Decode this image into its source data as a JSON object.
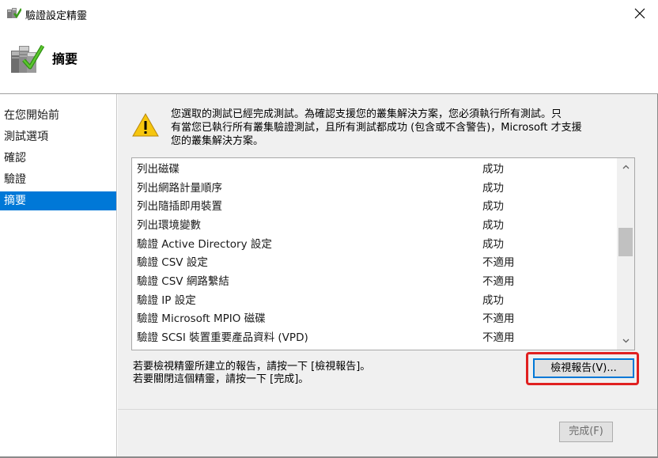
{
  "window": {
    "title": "驗證設定精靈",
    "close_glyph": "✕"
  },
  "header": {
    "title": "摘要"
  },
  "nav": {
    "items": [
      {
        "label": "在您開始前",
        "active": false
      },
      {
        "label": "測試選項",
        "active": false
      },
      {
        "label": "確認",
        "active": false
      },
      {
        "label": "驗證",
        "active": false
      },
      {
        "label": "摘要",
        "active": true
      }
    ]
  },
  "warning": {
    "lines": [
      "您選取的測試已經完成測試。為確認支援您的叢集解決方案，您必須執行所有測試。只",
      "有當您已執行所有叢集驗證測試，且所有測試都成功 (包含或不含警告)，Microsoft 才支援",
      "您的叢集解決方案。"
    ]
  },
  "results": {
    "rows": [
      {
        "name": "列出磁碟",
        "status": "成功"
      },
      {
        "name": "列出網路計量順序",
        "status": "成功"
      },
      {
        "name": "列出隨插即用裝置",
        "status": "成功"
      },
      {
        "name": "列出環境變數",
        "status": "成功"
      },
      {
        "name": "驗證 Active Directory 設定",
        "status": "成功"
      },
      {
        "name": "驗證 CSV 設定",
        "status": "不適用"
      },
      {
        "name": "驗證 CSV 網路繫結",
        "status": "不適用"
      },
      {
        "name": "驗證 IP 設定",
        "status": "成功"
      },
      {
        "name": "驗證 Microsoft MPIO 磁碟",
        "status": "不適用"
      },
      {
        "name": "驗證 SCSI 裝置重要產品資料 (VPD)",
        "status": "不適用"
      }
    ]
  },
  "info": {
    "line1": "若要檢視精靈所建立的報告，請按一下 [檢視報告]。",
    "line2": "若要關閉這個精靈，請按一下 [完成]。"
  },
  "buttons": {
    "view_report": "檢視報告(V)...",
    "finish": "完成(F)"
  },
  "colors": {
    "accent": "#0078d7",
    "highlight": "#e02020",
    "warning_yellow": "#f6c60e"
  }
}
